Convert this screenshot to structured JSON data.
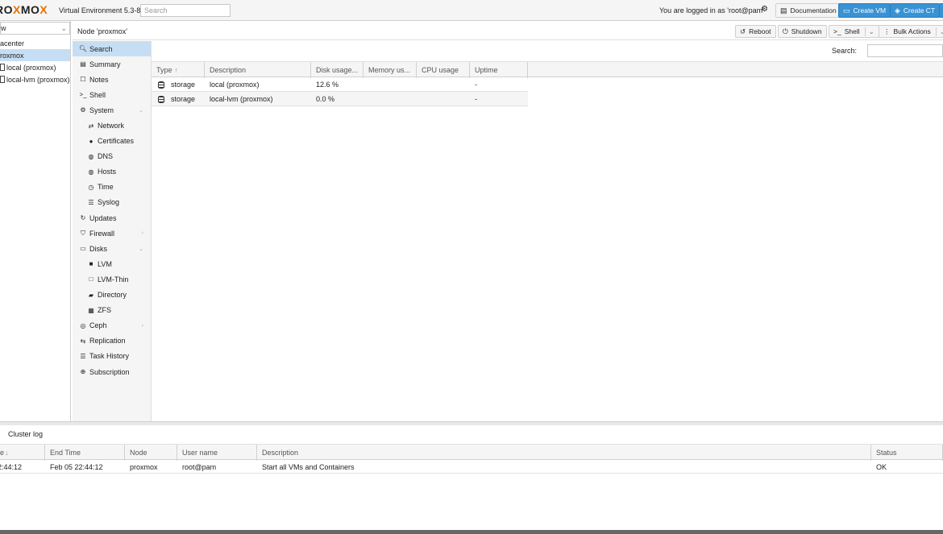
{
  "header": {
    "logo_prefix": "RO",
    "logo_x": "X",
    "logo_mid": "MO",
    "logo_suffix": "X",
    "version": "Virtual Environment 5.3-8",
    "search_placeholder": "Search",
    "logged_in": "You are logged in as 'root@pam'",
    "documentation": "Documentation",
    "create_vm": "Create VM",
    "create_ct": "Create CT",
    "accent": "#3892d4"
  },
  "tree": {
    "view": "w",
    "items": [
      {
        "label": "acenter"
      },
      {
        "label": "roxmox"
      },
      {
        "label": "local (proxmox)"
      },
      {
        "label": "local-lvm (proxmox)"
      }
    ]
  },
  "node": {
    "title": "Node 'proxmox'",
    "reboot": "Reboot",
    "shutdown": "Shutdown",
    "shell": "Shell",
    "bulk_actions": "Bulk Actions"
  },
  "menu": [
    {
      "label": "Search",
      "icon": "search-icon"
    },
    {
      "label": "Summary",
      "icon": "book-icon"
    },
    {
      "label": "Notes",
      "icon": "notes-icon"
    },
    {
      "label": "Shell",
      "icon": "terminal-icon"
    },
    {
      "label": "System",
      "icon": "gears-icon"
    },
    {
      "label": "Network",
      "icon": "exchange-icon"
    },
    {
      "label": "Certificates",
      "icon": "certificate-icon"
    },
    {
      "label": "DNS",
      "icon": "globe-icon"
    },
    {
      "label": "Hosts",
      "icon": "globe-icon"
    },
    {
      "label": "Time",
      "icon": "clock-icon"
    },
    {
      "label": "Syslog",
      "icon": "list-icon"
    },
    {
      "label": "Updates",
      "icon": "refresh-icon"
    },
    {
      "label": "Firewall",
      "icon": "shield-icon"
    },
    {
      "label": "Disks",
      "icon": "hdd-icon"
    },
    {
      "label": "LVM",
      "icon": "square-icon"
    },
    {
      "label": "LVM-Thin",
      "icon": "square-outline-icon"
    },
    {
      "label": "Directory",
      "icon": "folder-icon"
    },
    {
      "label": "ZFS",
      "icon": "th-large-icon"
    },
    {
      "label": "Ceph",
      "icon": "ceph-icon"
    },
    {
      "label": "Replication",
      "icon": "retweet-icon"
    },
    {
      "label": "Task History",
      "icon": "list-alt-icon"
    },
    {
      "label": "Subscription",
      "icon": "support-icon"
    }
  ],
  "grid": {
    "search_label": "Search:",
    "columns": [
      "Type",
      "Description",
      "Disk usage...",
      "Memory us...",
      "CPU usage",
      "Uptime"
    ],
    "sort_indicator": "↑",
    "rows": [
      {
        "type": "storage",
        "description": "local (proxmox)",
        "disk": "12.6 %",
        "memory": "",
        "cpu": "",
        "uptime": "-"
      },
      {
        "type": "storage",
        "description": "local-lvm (proxmox)",
        "disk": "0.0 %",
        "memory": "",
        "cpu": "",
        "uptime": "-"
      }
    ]
  },
  "cluster_log": {
    "title": "Cluster log",
    "columns": [
      "e",
      "End Time",
      "Node",
      "User name",
      "Description",
      "Status"
    ],
    "sort_indicator": "↓",
    "rows": [
      {
        "start": "2:44:12",
        "end": "Feb 05 22:44:12",
        "node": "proxmox",
        "user": "root@pam",
        "description": "Start all VMs and Containers",
        "status": "OK"
      }
    ]
  }
}
